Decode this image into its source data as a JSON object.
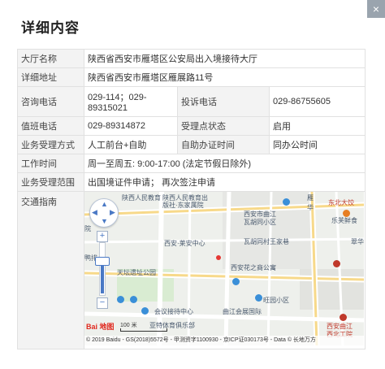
{
  "dialog": {
    "title": "详细内容",
    "close_label": "×"
  },
  "rows": {
    "hall_name": {
      "label": "大厅名称",
      "value": "陕西省西安市雁塔区公安局出入境接待大厅"
    },
    "address": {
      "label": "详细地址",
      "value": "陕西省西安市雁塔区雁展路11号"
    },
    "phone": {
      "label": "咨询电话",
      "value": "029-114；029-89315021",
      "label2": "投诉电话",
      "value2": "029-86755605"
    },
    "duty": {
      "label": "值班电话",
      "value": "029-89314872",
      "label2": "受理点状态",
      "value2": "启用"
    },
    "mode": {
      "label": "业务受理方式",
      "value": "人工前台+自助",
      "label2": "自助办证时间",
      "value2": "同办公时间"
    },
    "hours": {
      "label": "工作时间",
      "value": "周一至周五: 9:00-17:00  (法定节假日除外)"
    },
    "scope": {
      "label": "业务受理范围",
      "value": "出国境证件申请；  再次签注申请"
    },
    "traffic": {
      "label": "交通指南"
    }
  },
  "map": {
    "labels": {
      "l1": "陕西人民教育出",
      "l2": "版社·东家属院",
      "l3": "西安·莱安中心",
      "l4": "西安市曲江",
      "l5": "瓦胡同小区",
      "l6": "瓦胡同村王家巷",
      "l7": "西安花之商公寓",
      "l8": "天坛遗址公园",
      "l9": "旺园小区",
      "l10": "会议接待中心",
      "l11": "曲江会展国际",
      "l12": "亚特体育俱乐部",
      "l13": "东北大饺",
      "l14": "乐芙鲜食",
      "l15": "西安曲江",
      "l16": "西北工院",
      "l17": "陕西人民教育",
      "l18": "院",
      "l19": "鸭排",
      "l20": "雁",
      "l21": "华",
      "l22": "翠华"
    },
    "logo": "Bai 地图",
    "scale": "100 米",
    "copyright": "© 2019 Baidu - GS(2018)5572号 - 甲测资字1100930 - 京ICP证030173号 - Data © 长地万方",
    "zoom_in": "+",
    "zoom_out": "−"
  }
}
